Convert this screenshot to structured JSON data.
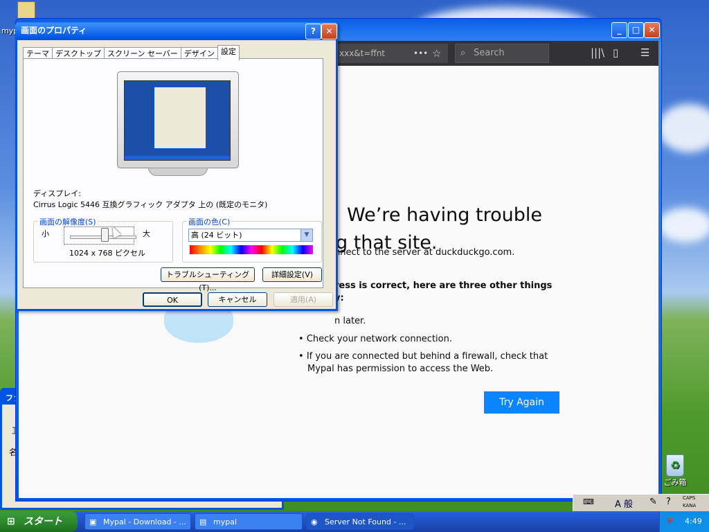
{
  "desktop": {
    "recycle_bin_label": "ごみ箱",
    "icon_top_label": "myp"
  },
  "background_window": {
    "title_fragment": "ファ",
    "text_line1": "ｴ",
    "text_line2": "名"
  },
  "browser": {
    "url_fragment": "xxx&t=ffnt",
    "search_placeholder": "Search",
    "error_title_line1": "We’re having trouble",
    "error_title_line2": "g that site.",
    "error_line1": "nnect to the server at duckduckgo.com.",
    "error_line2": "ress is correct, here are three other things",
    "error_line2b": "y:",
    "bullet1": "n later.",
    "bullet2": "Check your network connection.",
    "bullet3a": "If you are connected but behind a firewall, check that",
    "bullet3b": "Mypal has permission to access the Web.",
    "try_again_label": "Try Again"
  },
  "dialog": {
    "title": "画面のプロパティ",
    "help_btn": "?",
    "close_btn": "✕",
    "tabs": [
      "テーマ",
      "デスクトップ",
      "スクリーン セーバー",
      "デザイン",
      "設定"
    ],
    "active_tab": "設定",
    "display_label": "ディスプレイ:",
    "display_value": "Cirrus Logic 5446 互換グラフィック アダプタ 上の (既定のモニタ)",
    "resolution_group": "画面の解像度(S)",
    "res_small": "小",
    "res_large": "大",
    "res_value": "1024 x 768 ピクセル",
    "color_group": "画面の色(C)",
    "color_value": "高 (24 ビット)",
    "troubleshoot_btn": "トラブルシューティング(T)...",
    "advanced_btn": "詳細設定(V)",
    "ok_btn": "OK",
    "cancel_btn": "キャンセル",
    "apply_btn": "適用(A)"
  },
  "taskbar": {
    "start_label": "スタート",
    "tasks": [
      "Mypal - Download - ...",
      "mypal",
      "Server Not Found - ..."
    ],
    "clock": "4:49"
  },
  "langbar": {
    "mode_label": "A 般",
    "caps": "CAPS",
    "kana": "KANA"
  },
  "colors": {
    "xp_blue": "#0054e3",
    "firefox_button": "#0a84ff"
  }
}
